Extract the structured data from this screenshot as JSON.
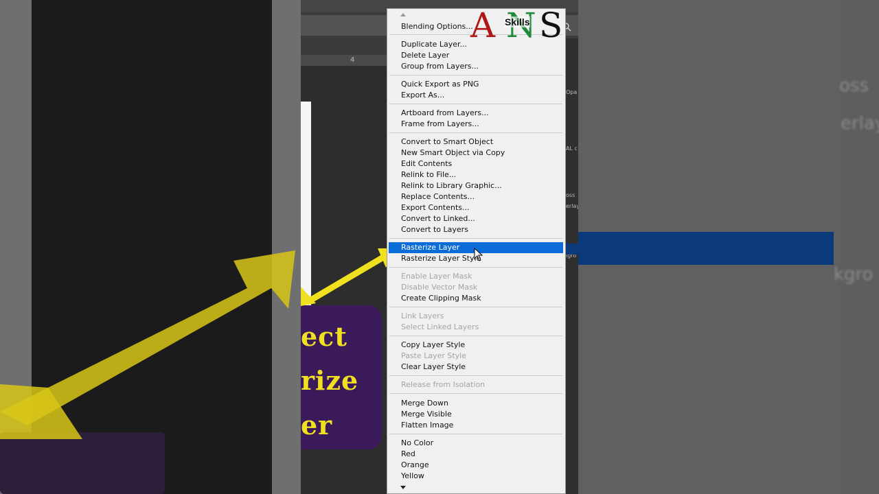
{
  "menu": {
    "items": [
      {
        "label": "Blending Options...",
        "disabled": false
      },
      {
        "label": "Duplicate Layer...",
        "disabled": false
      },
      {
        "label": "Delete Layer",
        "disabled": false
      },
      {
        "label": "Group from Layers...",
        "disabled": false
      },
      {
        "label": "Quick Export as PNG",
        "disabled": false
      },
      {
        "label": "Export As...",
        "disabled": false
      },
      {
        "label": "Artboard from Layers...",
        "disabled": false
      },
      {
        "label": "Frame from Layers...",
        "disabled": false
      },
      {
        "label": "Convert to Smart Object",
        "disabled": false
      },
      {
        "label": "New Smart Object via Copy",
        "disabled": false
      },
      {
        "label": "Edit Contents",
        "disabled": false
      },
      {
        "label": "Relink to File...",
        "disabled": false
      },
      {
        "label": "Relink to Library Graphic...",
        "disabled": false
      },
      {
        "label": "Replace Contents...",
        "disabled": false
      },
      {
        "label": "Export Contents...",
        "disabled": false
      },
      {
        "label": "Convert to Linked...",
        "disabled": false
      },
      {
        "label": "Convert to Layers",
        "disabled": false
      },
      {
        "label": "Rasterize Layer",
        "disabled": false,
        "selected": true
      },
      {
        "label": "Rasterize Layer Style",
        "disabled": false
      },
      {
        "label": "Enable Layer Mask",
        "disabled": true
      },
      {
        "label": "Disable Vector Mask",
        "disabled": true
      },
      {
        "label": "Create Clipping Mask",
        "disabled": false
      },
      {
        "label": "Link Layers",
        "disabled": true
      },
      {
        "label": "Select Linked Layers",
        "disabled": true
      },
      {
        "label": "Copy Layer Style",
        "disabled": false
      },
      {
        "label": "Paste Layer Style",
        "disabled": true
      },
      {
        "label": "Clear Layer Style",
        "disabled": false
      },
      {
        "label": "Release from Isolation",
        "disabled": true
      },
      {
        "label": "Merge Down",
        "disabled": false
      },
      {
        "label": "Merge Visible",
        "disabled": false
      },
      {
        "label": "Flatten Image",
        "disabled": false
      },
      {
        "label": "No Color",
        "disabled": false
      },
      {
        "label": "Red",
        "disabled": false
      },
      {
        "label": "Orange",
        "disabled": false
      },
      {
        "label": "Yellow",
        "disabled": false
      }
    ],
    "selected_color": "#0a6cd6"
  },
  "logo": {
    "letter1": "A",
    "letter2": "N",
    "letter3": "S",
    "tag": "Skills"
  },
  "overlay": {
    "line1": "ect",
    "line2": "rize",
    "line3": "er"
  },
  "canvas": {
    "ruler_tick": "4"
  },
  "side_right": {
    "text1": "oss",
    "text2": "erlay",
    "text3": "kgro"
  },
  "ps_panel": {
    "t1": "Opa",
    "t2": "AL c",
    "t3": "oss",
    "t4": "erlay",
    "t5": "igro"
  },
  "colors": {
    "arrow": "#f0e020",
    "highlight": "#0a3a7a"
  }
}
